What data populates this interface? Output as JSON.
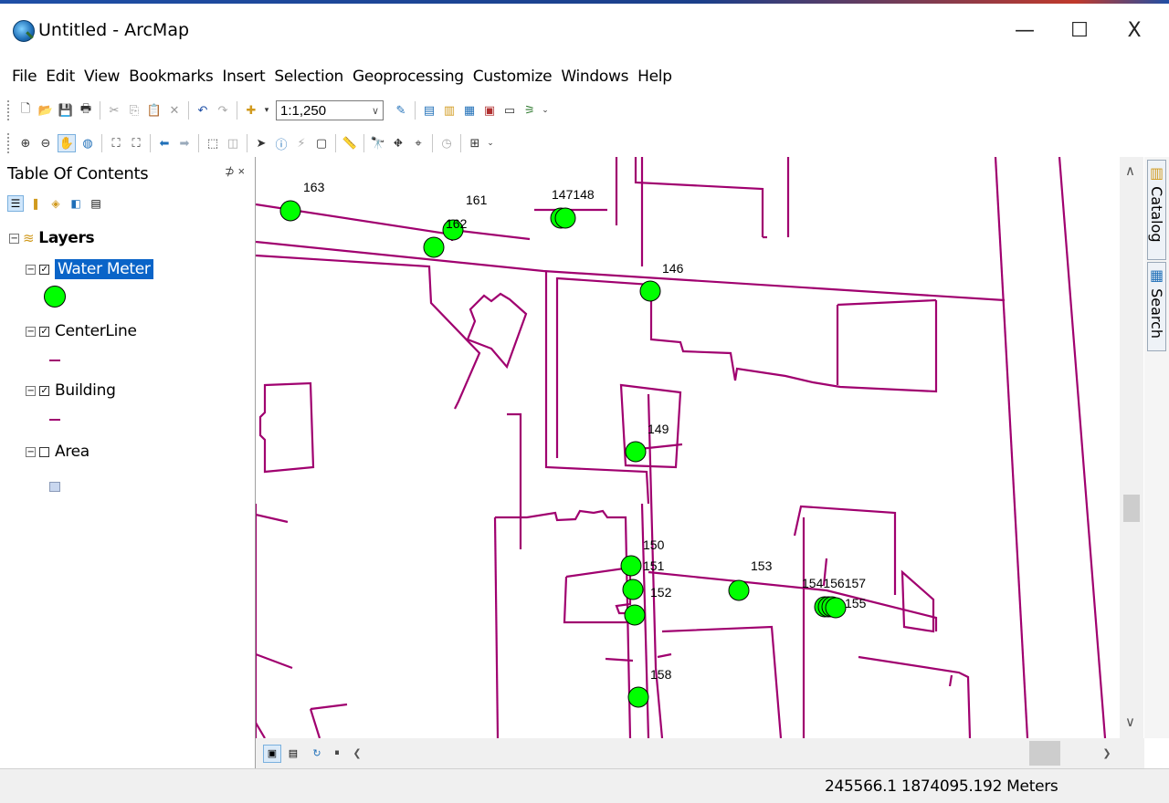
{
  "window": {
    "title": "Untitled - ArcMap",
    "minimize": "—",
    "maximize": "☐",
    "close": "X"
  },
  "menu": [
    "File",
    "Edit",
    "View",
    "Bookmarks",
    "Insert",
    "Selection",
    "Geoprocessing",
    "Customize",
    "Windows",
    "Help"
  ],
  "toolbar": {
    "scale": "1:1,250"
  },
  "toc": {
    "title": "Table Of Contents",
    "pin": "⊅ ×",
    "root_label": "Layers",
    "layers": [
      {
        "name": "Water Meter",
        "checked": true,
        "selected": true,
        "symbol": "green-circle",
        "color": "#00ff00"
      },
      {
        "name": "CenterLine",
        "checked": true,
        "selected": false,
        "symbol": "line",
        "color": "#a0006f"
      },
      {
        "name": "Building",
        "checked": true,
        "selected": false,
        "symbol": "line",
        "color": "#a0006f"
      },
      {
        "name": "Area",
        "checked": false,
        "selected": false,
        "symbol": "fill",
        "color": "#c9d7ef"
      }
    ]
  },
  "map": {
    "meter_color": "#00ff00",
    "line_color": "#a0006f",
    "meters": [
      {
        "id": "163",
        "label": "163"
      },
      {
        "id": "161",
        "label": "161"
      },
      {
        "id": "162",
        "label": "162"
      },
      {
        "id": "147148",
        "label": "147148"
      },
      {
        "id": "146",
        "label": "146"
      },
      {
        "id": "149",
        "label": "149"
      },
      {
        "id": "150",
        "label": "150"
      },
      {
        "id": "151",
        "label": "151"
      },
      {
        "id": "152",
        "label": "152"
      },
      {
        "id": "153",
        "label": "153"
      },
      {
        "id": "154156157",
        "label": "154156157"
      },
      {
        "id": "155",
        "label": "155"
      },
      {
        "id": "158",
        "label": "158"
      }
    ]
  },
  "side_tabs": {
    "catalog": "Catalog",
    "search": "Search"
  },
  "status": {
    "coordinates": "245566.1  1874095.192 Meters"
  }
}
